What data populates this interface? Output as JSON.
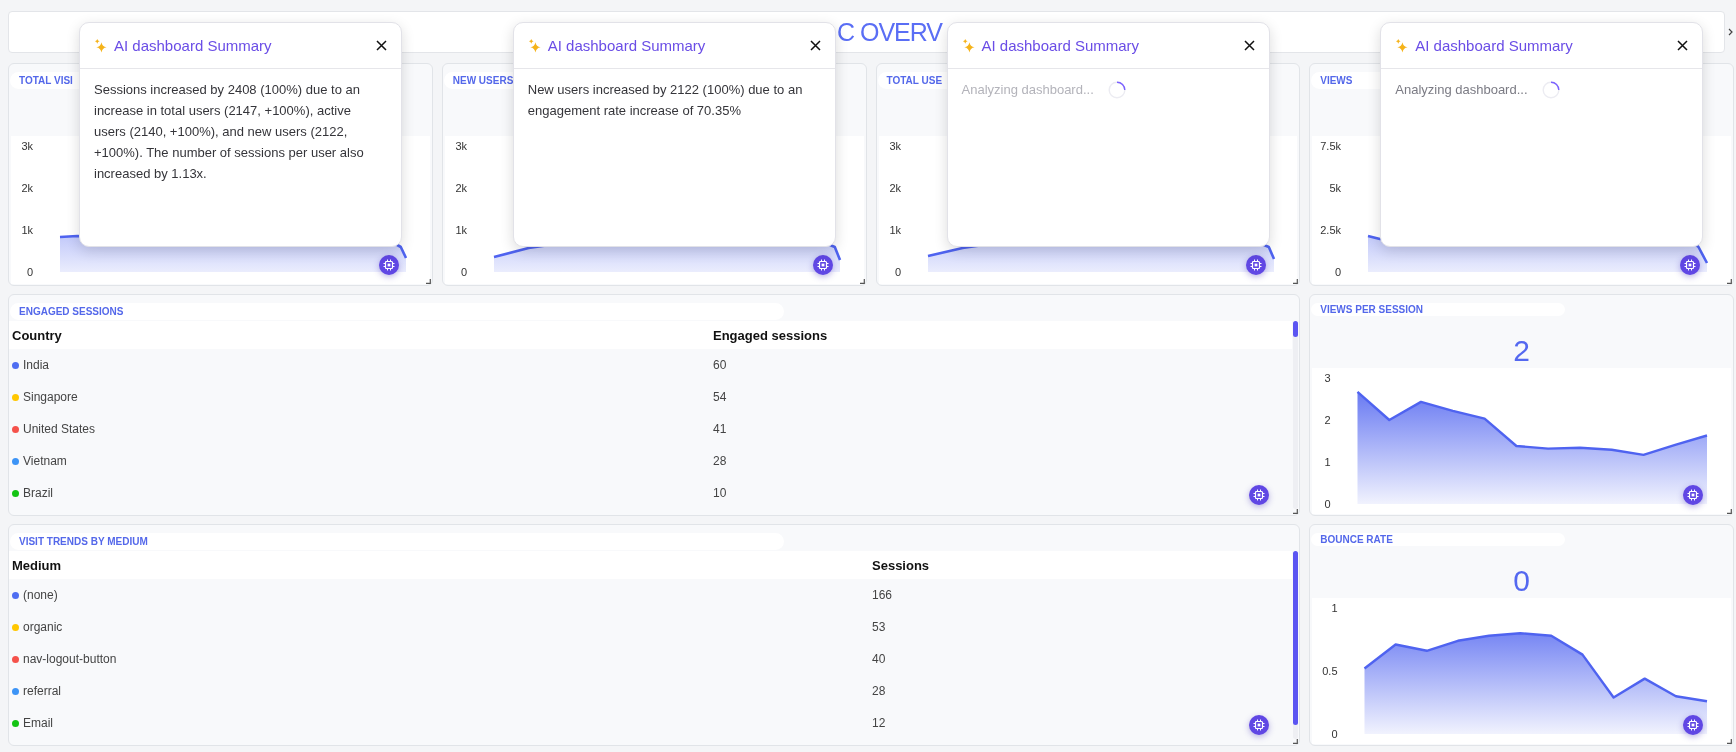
{
  "header": {
    "title": "C OVERV"
  },
  "metric_cards": [
    {
      "title": "TOTAL VISI",
      "y_ticks": [
        "3k",
        "2k",
        "1k",
        "0"
      ],
      "popup": {
        "title": "AI dashboard Summary",
        "kind": "summary",
        "text": "Sessions increased by 2408 (100%) due to an increase in total users (2147, +100%), active users (2140, +100%), and new users (2122, +100%). The number of sessions per user also increased by 1.13x.",
        "dimmed": false
      }
    },
    {
      "title": "NEW USERS",
      "y_ticks": [
        "3k",
        "2k",
        "1k",
        "0"
      ],
      "popup": {
        "title": "AI dashboard Summary",
        "kind": "summary",
        "text": "New users increased by 2122 (100%) due to an engagement rate increase of 70.35%",
        "dimmed": false
      }
    },
    {
      "title": "TOTAL USE",
      "y_ticks": [
        "3k",
        "2k",
        "1k",
        "0"
      ],
      "popup": {
        "title": "AI dashboard Summary",
        "kind": "loading",
        "text": "Analyzing dashboard...",
        "dimmed": true
      }
    },
    {
      "title": "VIEWS",
      "y_ticks": [
        "7.5k",
        "5k",
        "2.5k",
        "0"
      ],
      "popup": {
        "title": "AI dashboard Summary",
        "kind": "loading",
        "text": "Analyzing dashboard...",
        "dimmed": false
      }
    }
  ],
  "tables": [
    {
      "title": "ENGAGED SESSIONS",
      "columns": [
        "Country",
        "Engaged sessions"
      ],
      "rows": [
        {
          "label": "India",
          "value": "60",
          "color": "#4f6ef2"
        },
        {
          "label": "Singapore",
          "value": "54",
          "color": "#ffc700"
        },
        {
          "label": "United States",
          "value": "41",
          "color": "#f5524b"
        },
        {
          "label": "Vietnam",
          "value": "28",
          "color": "#3d94f6"
        },
        {
          "label": "Brazil",
          "value": "10",
          "color": "#14c414"
        }
      ]
    },
    {
      "title": "VISIT TRENDS BY MEDIUM",
      "columns": [
        "Medium",
        "Sessions"
      ],
      "rows": [
        {
          "label": "(none)",
          "value": "166",
          "color": "#4f6ef2"
        },
        {
          "label": "organic",
          "value": "53",
          "color": "#ffc700"
        },
        {
          "label": "nav-logout-button",
          "value": "40",
          "color": "#f5524b"
        },
        {
          "label": "referral",
          "value": "28",
          "color": "#3d94f6"
        },
        {
          "label": "Email",
          "value": "12",
          "color": "#14c414"
        }
      ]
    }
  ],
  "chart_cards": [
    {
      "title": "VIEWS PER SESSION",
      "value": "2",
      "chart_data": {
        "type": "area",
        "categories": [
          null,
          null,
          null,
          null,
          null,
          null,
          null,
          null,
          null,
          null,
          null,
          null
        ],
        "ylim": [
          0,
          3
        ],
        "yticks": [
          0,
          1,
          2,
          3
        ],
        "series": [
          {
            "color": "#4f63f0",
            "values": [
              2.67,
              2.0,
              2.43,
              2.22,
              2.03,
              1.38,
              1.32,
              1.34,
              1.29,
              1.17,
              1.41,
              1.63
            ]
          }
        ]
      }
    },
    {
      "title": "BOUNCE RATE",
      "value": "0",
      "chart_data": {
        "type": "area",
        "categories": [
          null,
          null,
          null,
          null,
          null,
          null,
          null,
          null,
          null,
          null,
          null,
          null
        ],
        "ylim": [
          0,
          1
        ],
        "yticks": [
          0,
          0.5,
          1
        ],
        "series": [
          {
            "color": "#4f63f0",
            "values": [
              0.52,
              0.71,
              0.66,
              0.74,
              0.78,
              0.8,
              0.78,
              0.63,
              0.29,
              0.44,
              0.3,
              0.26
            ]
          }
        ]
      }
    }
  ]
}
